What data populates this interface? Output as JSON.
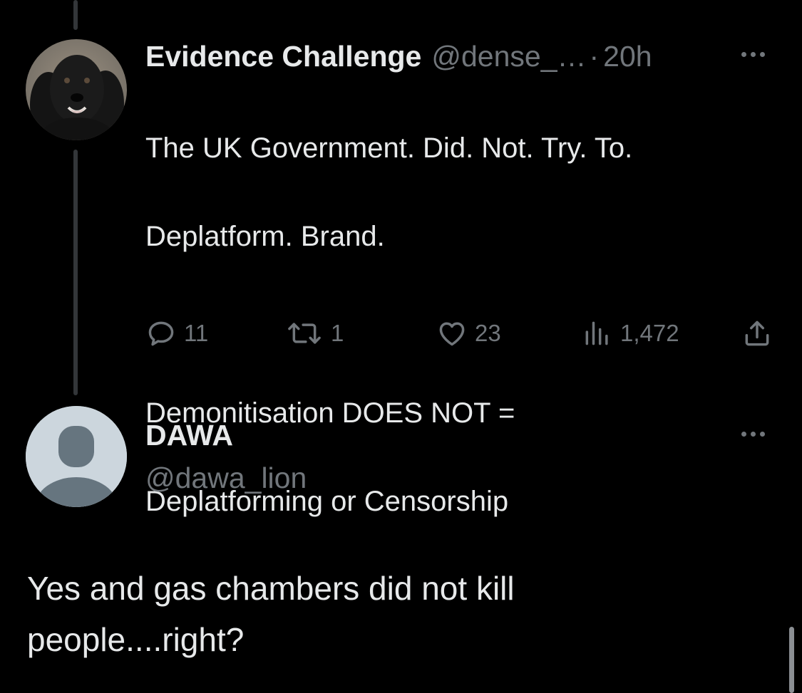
{
  "tweet": {
    "display_name": "Evidence Challenge",
    "handle": "@dense_…",
    "separator": "·",
    "time": "20h",
    "avatar_icon": "dog-photo-avatar",
    "text_line1": "The UK Government. Did. Not. Try. To.",
    "text_line2": "Deplatform. Brand.",
    "text_line3": "Demonitisation DOES NOT =",
    "text_line4": "Deplatforming or Censorship",
    "actions": {
      "replies": "11",
      "retweets": "1",
      "likes": "23",
      "views": "1,472"
    }
  },
  "reply": {
    "display_name": "DAWA",
    "handle": "@dawa_lion",
    "avatar_icon": "default-avatar",
    "text_line1": "Yes and gas chambers did not kill",
    "text_line2": "people....right?"
  },
  "colors": {
    "background": "#000000",
    "text_primary": "#e7e9ea",
    "text_secondary": "#71767b",
    "thread_line": "#333639"
  }
}
